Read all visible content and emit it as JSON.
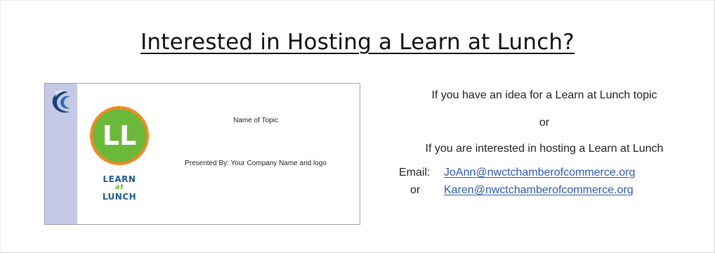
{
  "heading": "Interested in Hosting a Learn at Lunch?",
  "card": {
    "logo_initials": "LL",
    "logo_line1": "LEARN",
    "logo_line2": "at",
    "logo_line3": "LUNCH",
    "topic_label": "Name of Topic",
    "presenter_label": "Presented By: Your Company Name and logo"
  },
  "info": {
    "line1": "If you have an idea for a Learn at Lunch topic",
    "line2": "or",
    "line3": "If you are interested in hosting a Learn at Lunch",
    "email_label": "Email:",
    "or_label": "or",
    "email1": "JoAnn@nwctchamberofcommerce.org",
    "email2": "Karen@nwctchamberofcommerce.org"
  },
  "colors": {
    "strip": "#c6c9e6",
    "logo_ring": "#f08a24",
    "logo_fill": "#6cb83a",
    "logo_text": "#1d5c8f",
    "link": "#2b58b0"
  },
  "icons": [
    "chamber-swirl-icon",
    "learn-at-lunch-logo"
  ]
}
